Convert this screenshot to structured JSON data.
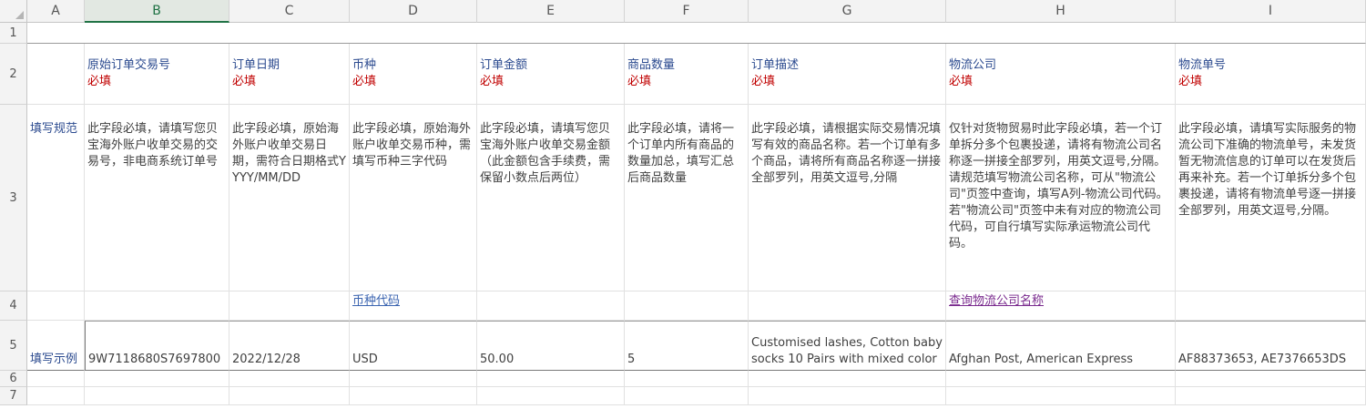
{
  "columns": [
    "A",
    "B",
    "C",
    "D",
    "E",
    "F",
    "G",
    "H",
    "I"
  ],
  "selected_column": "B",
  "rows": [
    "1",
    "2",
    "3",
    "4",
    "5",
    "6",
    "7"
  ],
  "header_fields": [
    {
      "title": "原始订单交易号",
      "req": "必填"
    },
    {
      "title": "订单日期",
      "req": "必填"
    },
    {
      "title": "币种",
      "req": "必填"
    },
    {
      "title": "订单金额",
      "req": "必填"
    },
    {
      "title": "商品数量",
      "req": "必填"
    },
    {
      "title": "订单描述",
      "req": "必填"
    },
    {
      "title": "物流公司",
      "req": "必填"
    },
    {
      "title": "物流单号",
      "req": "必填"
    }
  ],
  "row3_label": "填写规范",
  "rules": [
    "此字段必填，请填写您贝宝海外账户收单交易的交易号，非电商系统订单号",
    "此字段必填，原始海外账户收单交易日期，需符合日期格式YYYY/MM/DD",
    "此字段必填，原始海外账户收单交易币种，需填写币种三字代码",
    "此字段必填，请填写您贝宝海外账户收单交易金额（此金额包含手续费，需保留小数点后两位）",
    "此字段必填，请将一个订单内所有商品的数量加总，填写汇总后商品数量",
    "此字段必填，请根据实际交易情况填写有效的商品名称。若一个订单有多个商品，请将所有商品名称逐一拼接全部罗列，用英文逗号,分隔",
    "仅针对货物贸易时此字段必填，若一个订单拆分多个包裹投递，请将有物流公司名称逐一拼接全部罗列，用英文逗号,分隔。请规范填写物流公司名称，可从\"物流公司\"页签中查询，填写A列-物流公司代码。若\"物流公司\"页签中未有对应的物流公司代码，可自行填写实际承运物流公司代码。",
    "此字段必填，请填写实际服务的物流公司下准确的物流单号，未发货暂无物流信息的订单可以在发货后再来补充。若一个订单拆分多个包裹投递，请将有物流单号逐一拼接全部罗列，用英文逗号,分隔。"
  ],
  "row4_links": {
    "currency_code": "币种代码",
    "logistics_lookup": "查询物流公司名称"
  },
  "row5_label": "填写示例",
  "examples": [
    "9W7118680S7697800",
    "2022/12/28",
    "USD",
    "50.00",
    "5",
    "Customised lashes, Cotton baby socks 10 Pairs with mixed color",
    "Afghan Post, American Express",
    "AF88373653, AE7376653DS"
  ]
}
